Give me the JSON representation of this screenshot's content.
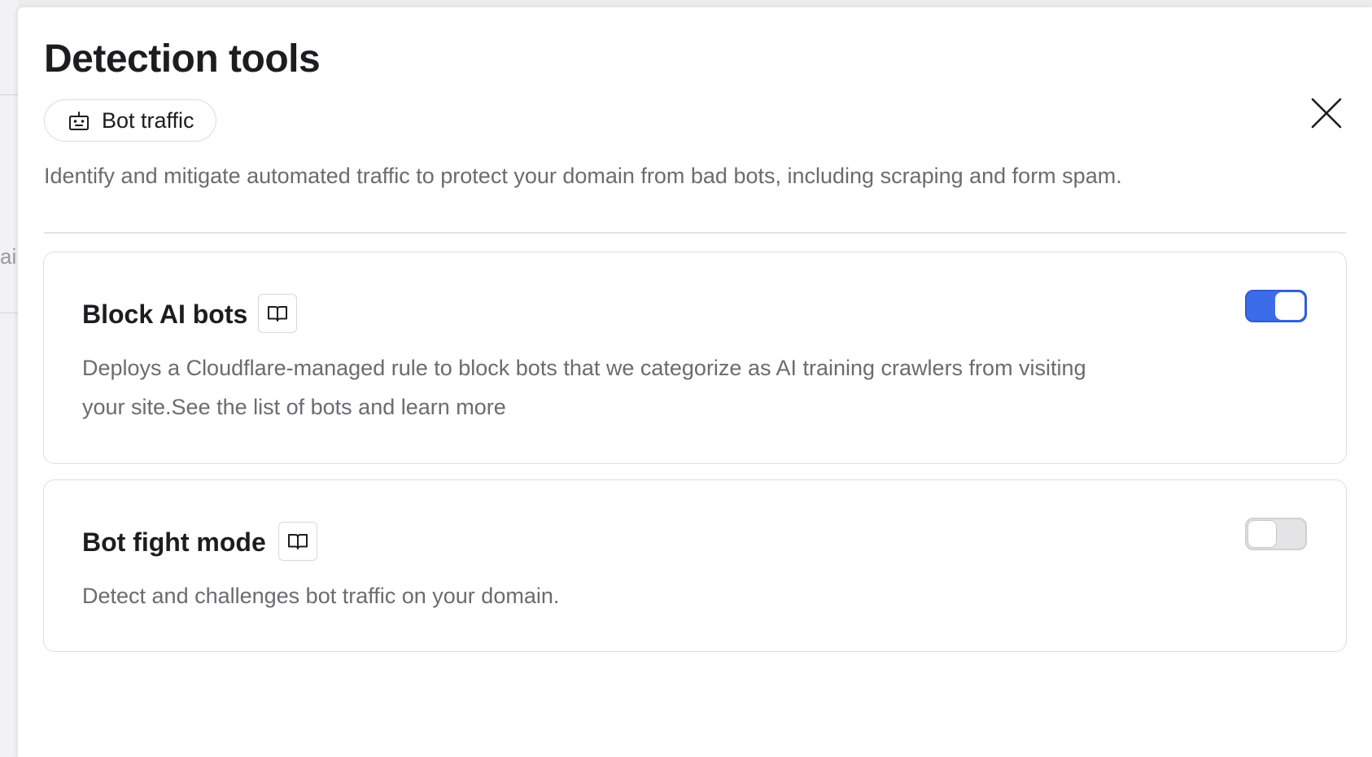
{
  "backdrop": {
    "partial_text": "ai"
  },
  "panel": {
    "title": "Detection tools",
    "tag": {
      "label": "Bot traffic",
      "icon": "robot-icon"
    },
    "close_icon": "close-icon",
    "description": "Identify and mitigate automated traffic to protect your domain from bad bots, including scraping and form spam."
  },
  "cards": [
    {
      "title": "Block AI bots",
      "doc_icon": "book-open-icon",
      "description": "Deploys a Cloudflare-managed rule to block bots that we categorize as AI training crawlers from visiting your site.See the list of bots and learn more",
      "enabled": true
    },
    {
      "title": "Bot fight mode",
      "doc_icon": "book-open-icon",
      "description": "Detect and challenges bot traffic on your domain.",
      "enabled": false
    }
  ],
  "colors": {
    "accent": "#3c6ce8",
    "toggle_off": "#e4e4e7",
    "text": "#1d1d1f",
    "muted": "#6b6b70"
  }
}
